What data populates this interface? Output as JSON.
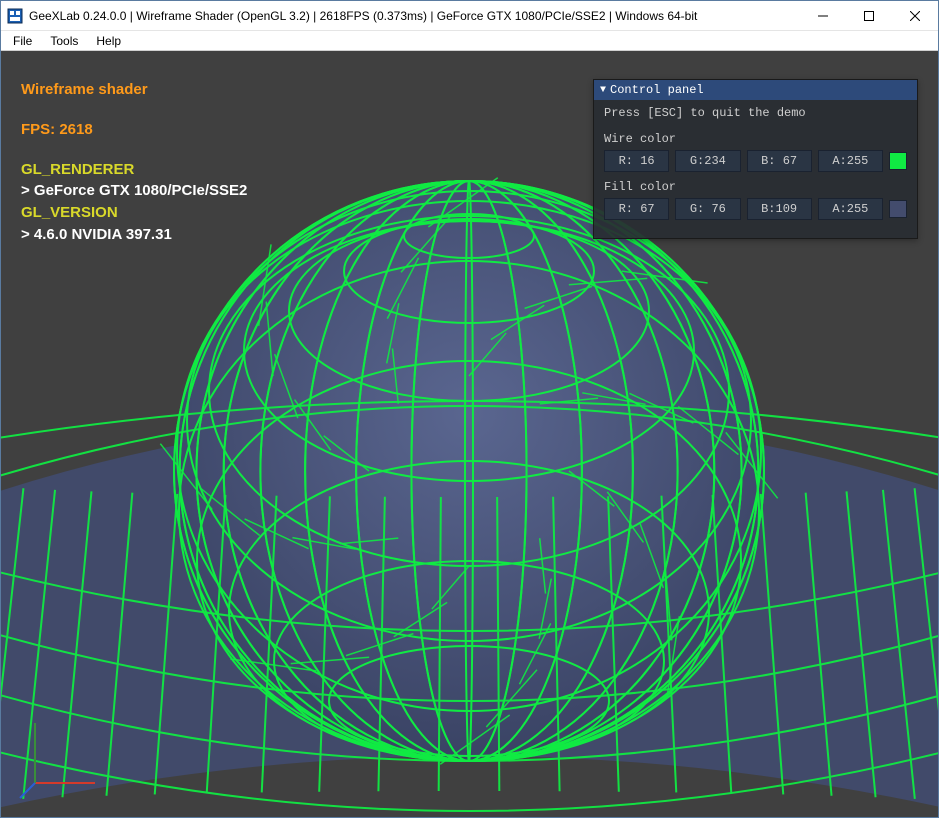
{
  "window": {
    "title": "GeeXLab 0.24.0.0 | Wireframe Shader (OpenGL 3.2) | 2618FPS (0.373ms) | GeForce GTX 1080/PCIe/SSE2 | Windows 64-bit"
  },
  "menu": {
    "file": "File",
    "tools": "Tools",
    "help": "Help"
  },
  "overlay": {
    "heading": "Wireframe shader",
    "fps_label": "FPS: 2618",
    "renderer_label": "GL_RENDERER",
    "renderer_value": "> GeForce GTX 1080/PCIe/SSE2",
    "version_label": "GL_VERSION",
    "version_value": "> 4.6.0 NVIDIA 397.31"
  },
  "panel": {
    "title": "Control panel",
    "hint": "Press [ESC] to quit the demo",
    "wire_label": "Wire color",
    "fill_label": "Fill color",
    "wire": {
      "r": "R: 16",
      "g": "G:234",
      "b": "B: 67",
      "a": "A:255",
      "swatch": "#10ea43"
    },
    "fill": {
      "r": "R: 67",
      "g": "G: 76",
      "b": "B:109",
      "a": "A:255",
      "swatch": "#434c6d"
    }
  },
  "colors": {
    "wire": "#10ea43",
    "fill": "#434c6d",
    "bg": "#404040"
  }
}
